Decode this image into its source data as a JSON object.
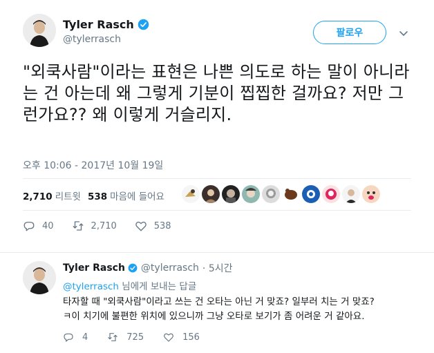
{
  "tweet": {
    "author_name": "Tyler Rasch",
    "author_handle": "@tylerrasch",
    "follow_label": "팔로우",
    "text": "\"외쿡사람\"이라는 표현은 나쁜 의도로 하는 말이 아니라는 건 아는데 왜 그렇게 기분이 찝찝한 걸까요? 저만 그런가요?? 왜 이렇게 거슬리지.",
    "timestamp": "오후 10:06 - 2017년 10월 19일",
    "retweets_count": "2,710",
    "retweets_label": "리트윗",
    "likes_count": "538",
    "likes_label": "마음에 들어요",
    "replies": "40",
    "retweets": "2,710",
    "likes": "538",
    "liker_avatars": [
      "liker-1",
      "liker-2",
      "liker-3",
      "liker-4",
      "liker-5",
      "liker-6",
      "liker-7",
      "liker-8",
      "liker-9"
    ]
  },
  "reply": {
    "author_name": "Tyler Rasch",
    "author_handle": "@tylerrasch",
    "time": "· 5시간",
    "to_handle": "@tylerrasch",
    "to_suffix": " 님에게 보내는 답글",
    "text_line1": "타자할 때 \"외쿡사람\"이라고 쓰는 건 오타는 아닌 거 맞죠? 일부러 치는 거 맞죠?",
    "text_line2": "ㅋ이 치기에 불편한 위치에 있으니까 그냥 오타로 보기가 좀 어려운 거 같아요.",
    "replies": "4",
    "retweets": "725",
    "likes": "156"
  },
  "colors": {
    "accent": "#1da1f2",
    "retweet": "#17bf63",
    "like": "#e0245e",
    "muted": "#657786"
  }
}
